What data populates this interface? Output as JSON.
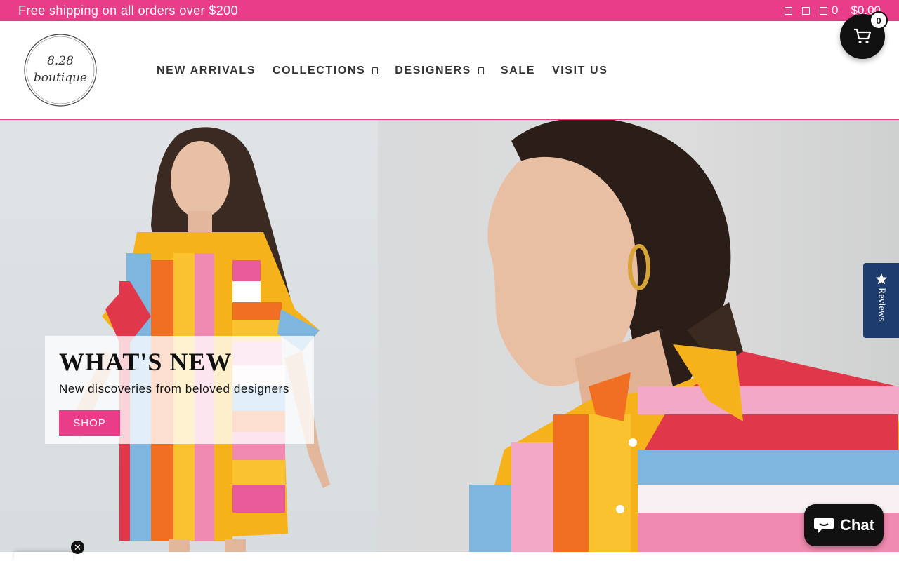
{
  "announcement": {
    "text": "Free shipping on all orders over $200",
    "cart_count": "0",
    "cart_total": "$0.00"
  },
  "header": {
    "logo_line1": "8.28",
    "logo_line2": "boutique",
    "nav": [
      {
        "label": "NEW ARRIVALS",
        "has_dropdown": false
      },
      {
        "label": "COLLECTIONS",
        "has_dropdown": true
      },
      {
        "label": "DESIGNERS",
        "has_dropdown": true
      },
      {
        "label": "SALE",
        "has_dropdown": false
      },
      {
        "label": "VISIT US",
        "has_dropdown": false
      }
    ]
  },
  "floating_cart": {
    "count": "0",
    "icon": "cart-icon"
  },
  "hero": {
    "title": "WHAT'S NEW",
    "subtitle": "New discoveries from beloved designers",
    "button_label": "SHOP"
  },
  "reviews_tab": {
    "label": "Reviews",
    "icon": "star-icon"
  },
  "chat": {
    "label": "Chat",
    "icon": "chat-bubble-icon"
  },
  "colors": {
    "brand_pink": "#e93d8a",
    "reviews_blue": "#1f3c6e",
    "dark": "#111111"
  }
}
